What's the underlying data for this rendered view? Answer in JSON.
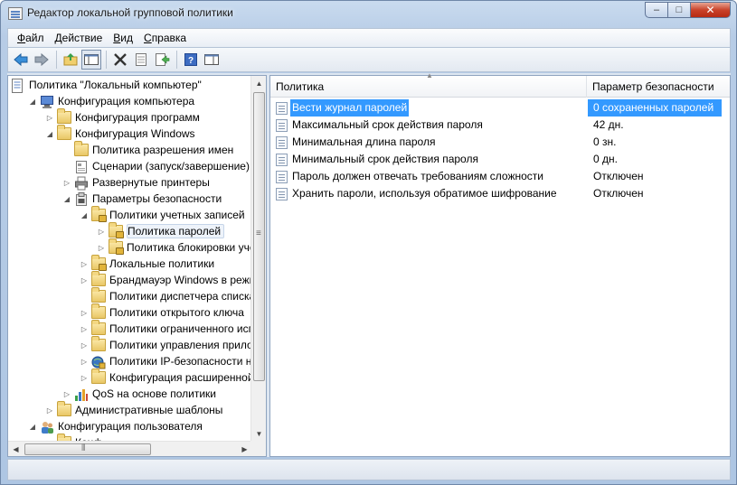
{
  "window": {
    "title": "Редактор локальной групповой политики",
    "buttons": {
      "minimize": "–",
      "maximize": "□",
      "close": "✕"
    }
  },
  "menu": [
    {
      "label": "Файл",
      "accel": "Ф",
      "rest": "айл"
    },
    {
      "label": "Действие",
      "accel": "Д",
      "rest": "ействие"
    },
    {
      "label": "Вид",
      "accel": "В",
      "rest": "ид"
    },
    {
      "label": "Справка",
      "accel": "С",
      "rest": "правка"
    }
  ],
  "toolbar": [
    "back-arrow-icon",
    "forward-arrow-icon",
    "up-folder-icon",
    "show-hide-tree-icon",
    "delete-icon",
    "properties-icon",
    "export-list-icon",
    "help-icon",
    "show-action-pane-icon"
  ],
  "tree": {
    "items": [
      {
        "label": "Политика \"Локальный компьютер\"",
        "level": 0,
        "expander": "",
        "icon": "document"
      },
      {
        "label": "Конфигурация компьютера",
        "level": 1,
        "expander": "open",
        "icon": "computer"
      },
      {
        "label": "Конфигурация программ",
        "level": 2,
        "expander": "closed",
        "icon": "folder"
      },
      {
        "label": "Конфигурация Windows",
        "level": 2,
        "expander": "open",
        "icon": "folder"
      },
      {
        "label": "Политика разрешения имен",
        "level": 3,
        "expander": "",
        "icon": "folder"
      },
      {
        "label": "Сценарии (запуск/завершение)",
        "level": 3,
        "expander": "",
        "icon": "script"
      },
      {
        "label": "Развернутые принтеры",
        "level": 3,
        "expander": "closed",
        "icon": "printer"
      },
      {
        "label": "Параметры безопасности",
        "level": 3,
        "expander": "open",
        "icon": "security"
      },
      {
        "label": "Политики учетных записей",
        "level": 4,
        "expander": "open",
        "icon": "lockfolder"
      },
      {
        "label": "Политика паролей",
        "level": 5,
        "expander": "closed",
        "icon": "lockfolder",
        "selected": true
      },
      {
        "label": "Политика блокировки уче",
        "level": 5,
        "expander": "closed",
        "icon": "lockfolder"
      },
      {
        "label": "Локальные политики",
        "level": 4,
        "expander": "closed",
        "icon": "lockfolder"
      },
      {
        "label": "Брандмауэр Windows в режим",
        "level": 4,
        "expander": "closed",
        "icon": "folder"
      },
      {
        "label": "Политики диспетчера списка",
        "level": 4,
        "expander": "",
        "icon": "folder"
      },
      {
        "label": "Политики открытого ключа",
        "level": 4,
        "expander": "closed",
        "icon": "folder"
      },
      {
        "label": "Политики ограниченного исп",
        "level": 4,
        "expander": "closed",
        "icon": "folder"
      },
      {
        "label": "Политики управления прилож",
        "level": 4,
        "expander": "closed",
        "icon": "folder"
      },
      {
        "label": "Политики IP-безопасности на",
        "level": 4,
        "expander": "closed",
        "icon": "ipsec"
      },
      {
        "label": "Конфигурация расширенной",
        "level": 4,
        "expander": "closed",
        "icon": "folder"
      },
      {
        "label": "QoS на основе политики",
        "level": 3,
        "expander": "closed",
        "icon": "chart"
      },
      {
        "label": "Административные шаблоны",
        "level": 2,
        "expander": "closed",
        "icon": "folder"
      },
      {
        "label": "Конфигурация пользователя",
        "level": 1,
        "expander": "open",
        "icon": "users"
      },
      {
        "label": "Конф",
        "level": 2,
        "expander": "closed",
        "icon": "folder"
      }
    ]
  },
  "list": {
    "columns": [
      "Политика",
      "Параметр безопасности"
    ],
    "rows": [
      {
        "policy": "Вести журнал паролей",
        "value": "0 сохраненных паролей",
        "selected": true
      },
      {
        "policy": "Максимальный срок действия пароля",
        "value": "42 дн."
      },
      {
        "policy": "Минимальная длина пароля",
        "value": "0 зн."
      },
      {
        "policy": "Минимальный срок действия пароля",
        "value": "0 дн."
      },
      {
        "policy": "Пароль должен отвечать требованиям сложности",
        "value": "Отключен"
      },
      {
        "policy": "Хранить пароли, используя обратимое шифрование",
        "value": "Отключен"
      }
    ]
  },
  "status": {
    "text": ""
  }
}
